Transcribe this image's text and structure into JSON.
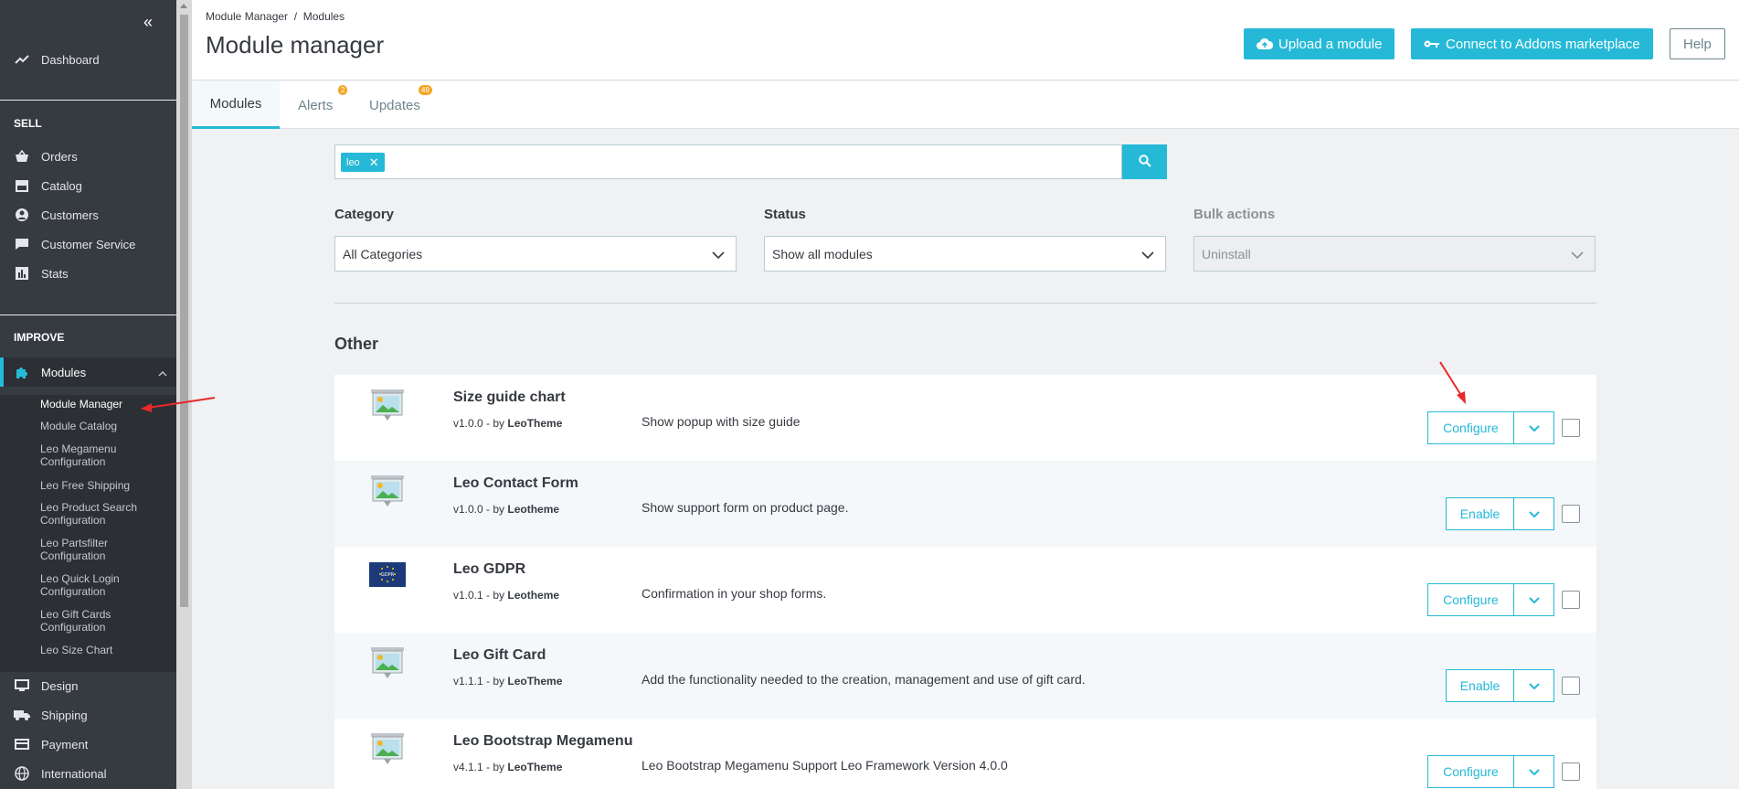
{
  "sidebar": {
    "dashboard": "Dashboard",
    "sell_title": "SELL",
    "sell_items": [
      "Orders",
      "Catalog",
      "Customers",
      "Customer Service",
      "Stats"
    ],
    "improve_title": "IMPROVE",
    "modules": "Modules",
    "sub_items": [
      "Module Manager",
      "Module Catalog",
      "Leo Megamenu Configuration",
      "Leo Free Shipping",
      "Leo Product Search Configuration",
      "Leo Partsfilter Configuration",
      "Leo Quick Login Configuration",
      "Leo Gift Cards Configuration",
      "Leo Size Chart"
    ],
    "bottom_items": [
      "Design",
      "Shipping",
      "Payment",
      "International"
    ]
  },
  "header": {
    "breadcrumb": "Module Manager  /  Modules",
    "title": "Module manager",
    "upload_label": "Upload a module",
    "connect_label": "Connect to Addons marketplace",
    "help_label": "Help"
  },
  "tabs": {
    "modules": "Modules",
    "alerts": "Alerts",
    "alerts_count": "2",
    "updates": "Updates",
    "updates_count": "49"
  },
  "search": {
    "chip": "leo"
  },
  "filters": {
    "category_label": "Category",
    "category_value": "All Categories",
    "status_label": "Status",
    "status_value": "Show all modules",
    "bulk_label": "Bulk actions",
    "bulk_value": "Uninstall"
  },
  "section_title": "Other",
  "modules": [
    {
      "name": "Size guide chart",
      "version": "v1.0.0 - by",
      "author": "LeoTheme",
      "desc": "Show popup with size guide",
      "action": "Configure"
    },
    {
      "name": "Leo Contact Form",
      "version": "v1.0.0 - by",
      "author": "Leotheme",
      "desc": "Show support form on product page.",
      "action": "Enable"
    },
    {
      "name": "Leo GDPR",
      "version": "v1.0.1 - by",
      "author": "Leotheme",
      "desc": "Confirmation in your shop forms.",
      "action": "Configure"
    },
    {
      "name": "Leo Gift Card",
      "version": "v1.1.1 - by",
      "author": "LeoTheme",
      "desc": "Add the functionality needed to the creation, management and use of gift card.",
      "action": "Enable"
    },
    {
      "name": "Leo Bootstrap Megamenu",
      "version": "v4.1.1 - by",
      "author": "LeoTheme",
      "desc": "Leo Bootstrap Megamenu Support Leo Framework Version 4.0.0",
      "action": "Configure"
    }
  ],
  "colors": {
    "accent": "#25b9d7",
    "sidebar": "#363a41",
    "badge": "#f5a623",
    "annotation": "#e8282b"
  }
}
